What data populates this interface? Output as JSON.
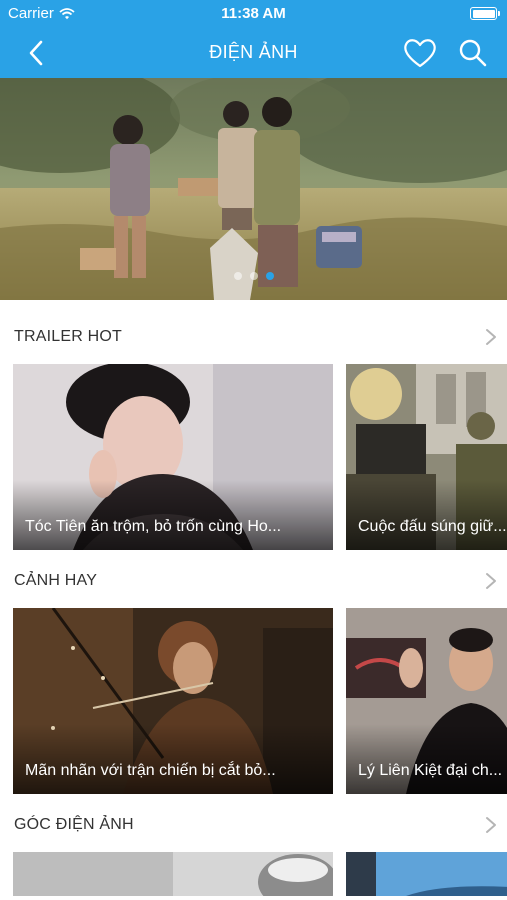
{
  "status_bar": {
    "carrier": "Carrier",
    "time": "11:38 AM",
    "wifi_icon": "wifi-icon",
    "battery_icon": "battery-icon"
  },
  "header": {
    "title": "ĐIỆN ẢNH",
    "back_icon": "chevron-left-icon",
    "favorite_icon": "heart-icon",
    "search_icon": "search-icon",
    "background_color": "#2aa2e6"
  },
  "hero": {
    "page_count": 3,
    "active_page": 2
  },
  "sections": [
    {
      "title": "TRAILER HOT",
      "more_icon": "chevron-right-icon",
      "items": [
        {
          "caption": "Tóc Tiên ăn trộm, bỏ trốn cùng Ho..."
        },
        {
          "caption": "Cuộc đấu súng giữ..."
        }
      ]
    },
    {
      "title": "CẢNH HAY",
      "more_icon": "chevron-right-icon",
      "items": [
        {
          "caption": "Mãn nhãn với trận chiến bị cắt bỏ..."
        },
        {
          "caption": "Lý Liên Kiệt đại ch..."
        }
      ]
    },
    {
      "title": "GÓC ĐIỆN ẢNH",
      "more_icon": "chevron-right-icon",
      "items": [
        {
          "caption": ""
        },
        {
          "caption": ""
        }
      ]
    }
  ],
  "colors": {
    "accent": "#2aa2e6",
    "active_dot": "#2aa2e6",
    "section_title": "#333333"
  }
}
